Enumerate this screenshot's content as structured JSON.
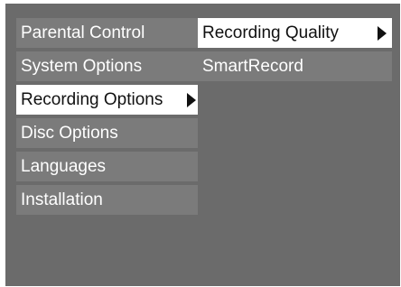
{
  "colors": {
    "background": "#6b6b6b",
    "item_background": "#7b7b7b",
    "selected_background": "#ffffff",
    "text": "#ffffff",
    "selected_text": "#111111"
  },
  "main_menu": {
    "items": [
      {
        "label": "Parental Control",
        "selected": false
      },
      {
        "label": "System Options",
        "selected": false
      },
      {
        "label": "Recording Options",
        "selected": true,
        "has_submenu": true,
        "arrow_icon": "triangle-right-icon"
      },
      {
        "label": "Disc Options",
        "selected": false
      },
      {
        "label": "Languages",
        "selected": false
      },
      {
        "label": "Installation",
        "selected": false
      }
    ]
  },
  "submenu": {
    "items": [
      {
        "label": "Recording Quality",
        "selected": true,
        "has_submenu": true,
        "arrow_icon": "triangle-right-icon"
      },
      {
        "label": "SmartRecord",
        "selected": false
      }
    ]
  }
}
